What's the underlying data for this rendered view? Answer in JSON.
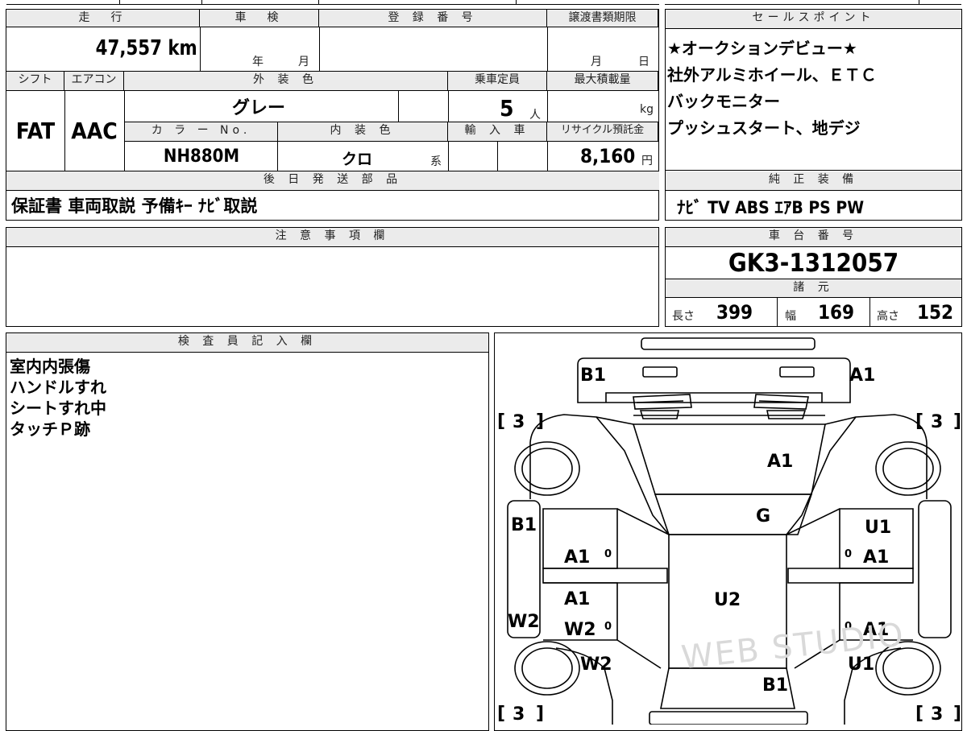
{
  "labels": {
    "mileage": "走　行",
    "inspection": "車　検",
    "registration": "登 録 番 号",
    "transfer_deadline": "譲渡書類期限",
    "sales_points": "セールスポイント",
    "shift": "シフト",
    "aircon": "エアコン",
    "exterior_color": "外 装 色",
    "capacity": "乗車定員",
    "max_load": "最大積載量",
    "color_no": "カ ラ ー No.",
    "interior_color": "内 装 色",
    "import": "輸 入 車",
    "recycle_fee": "リサイクル預託金",
    "later_parts": "後 日 発 送 部 品",
    "standard_equipment": "純 正 装 備",
    "notes": "注 意 事 項 欄",
    "chassis_no": "車 台 番 号",
    "specs": "諸 元",
    "inspector_notes": "検 査 員 記 入 欄"
  },
  "values": {
    "mileage": "47,557 km",
    "inspection_year": "年",
    "inspection_month": "月",
    "deadline_month": "月",
    "deadline_day": "日",
    "shift": "FAT",
    "aircon": "AAC",
    "exterior_color": "グレー",
    "capacity": "5",
    "capacity_unit": "人",
    "load_unit": "kg",
    "color_no": "NH880M",
    "interior_color": "クロ",
    "interior_suffix": "系",
    "recycle_fee": "8,160",
    "recycle_unit": "円",
    "later_parts": "保証書 車両取説 予備ｷｰ ﾅﾋﾞ取説",
    "standard_equipment": "ﾅﾋﾞ TV ABS ｴｱB PS PW",
    "chassis_no": "GK3-1312057",
    "length_label": "長さ",
    "length": "399",
    "width_label": "幅",
    "width": "169",
    "height_label": "高さ",
    "height": "152"
  },
  "sales_points": [
    "★オークションデビュー★",
    "社外アルミホイール、ＥＴＣ",
    "バックモニター",
    "プッシュスタート、地デジ"
  ],
  "inspector_notes": [
    "室内内張傷",
    "ハンドルすれ",
    "シートすれ中",
    "タッチＰ跡"
  ],
  "diagram": {
    "marks": {
      "b1_front_left": "B1",
      "a1_front_right": "A1",
      "a1_windshield": "A1",
      "g_roof_front": "G",
      "b1_left_pillar": "B1",
      "a1_left_front_door": "A1",
      "a1_left_rear_top": "A1",
      "w2_left_rear": "W2",
      "w2_left_side": "W2",
      "w2_left_rear_fender": "W2",
      "u1_right_pillar": "U1",
      "a1_right_front_door": "A1",
      "a1_right_rear_door": "A1",
      "u1_right_rear_fender": "U1",
      "u2_roof": "U2",
      "b1_rear": "B1"
    },
    "tire_labels": [
      "3",
      "3",
      "3",
      "3"
    ],
    "small_zero": "0"
  },
  "watermark": "WEB STUDIO"
}
